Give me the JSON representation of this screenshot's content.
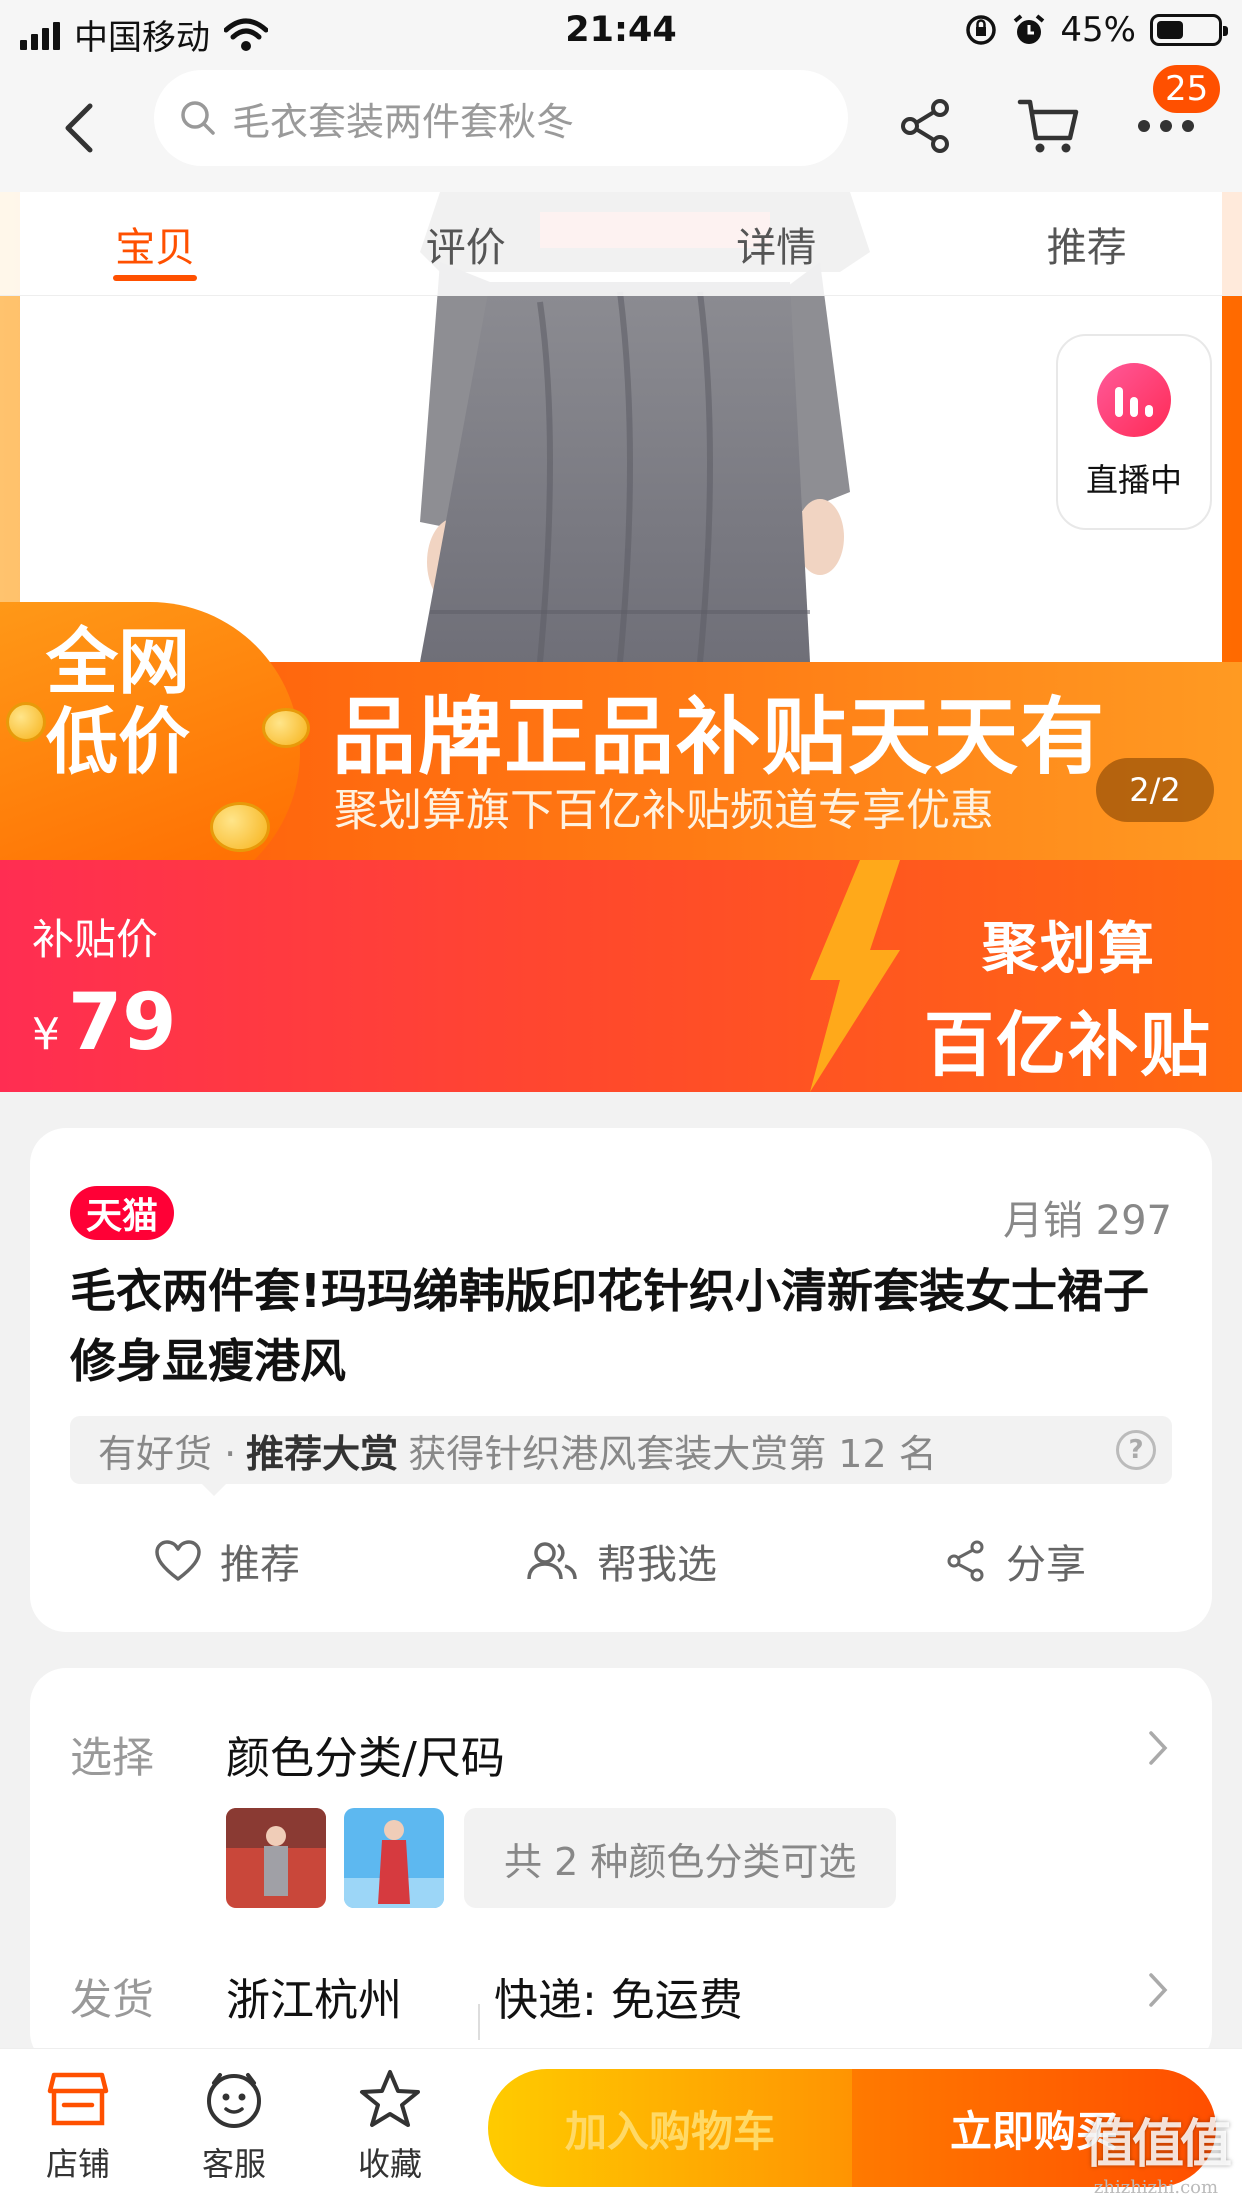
{
  "status_bar": {
    "carrier": "中国移动",
    "time": "21:44",
    "battery_percent": "45%",
    "battery_level": 0.45
  },
  "nav": {
    "search_placeholder": "毛衣套装两件套秋冬",
    "more_badge": "25"
  },
  "tabs": [
    {
      "label": "宝贝",
      "active": true
    },
    {
      "label": "评价",
      "active": false
    },
    {
      "label": "详情",
      "active": false
    },
    {
      "label": "推荐",
      "active": false
    }
  ],
  "live": {
    "label": "直播中"
  },
  "banner": {
    "low_price": "全网低价",
    "title": "品牌正品补贴天天有",
    "subtitle": "聚划算旗下百亿补贴频道专享优惠",
    "pager": "2/2"
  },
  "price": {
    "label": "补贴价",
    "currency": "¥",
    "value": "79",
    "brand_line1": "聚划算",
    "brand_line2": "百亿补贴"
  },
  "product": {
    "platform_badge": "天猫",
    "monthly_sales": "月销 297",
    "title": "毛衣两件套!玛玛绨韩版印花针织小清新套装女士裙子修身显瘦港风",
    "recommend": {
      "prefix": "有好货 ·",
      "award": "推荐大赏",
      "text": "获得针织港风套装大赏第 12 名",
      "help": "?"
    },
    "actions": [
      {
        "label": "推荐",
        "icon": "heart-icon"
      },
      {
        "label": "帮我选",
        "icon": "people-icon"
      },
      {
        "label": "分享",
        "icon": "share-icon"
      }
    ]
  },
  "options": {
    "select_label": "选择",
    "select_value": "颜色分类/尺码",
    "colors_count": "共 2 种颜色分类可选",
    "ship_label": "发货",
    "ship_from": "浙江杭州",
    "ship_method": "快递: 免运费"
  },
  "bottom": {
    "store": "店铺",
    "service": "客服",
    "favorite": "收藏",
    "add_to_cart": "加入购物车",
    "buy_now": "立即购买",
    "watermark": "值值值",
    "watermark_url": "zhizhizhi.com"
  },
  "colors": {
    "accent": "#ff5000",
    "tmall_red": "#ff0036",
    "subsidy_red": "#ff2d52"
  }
}
